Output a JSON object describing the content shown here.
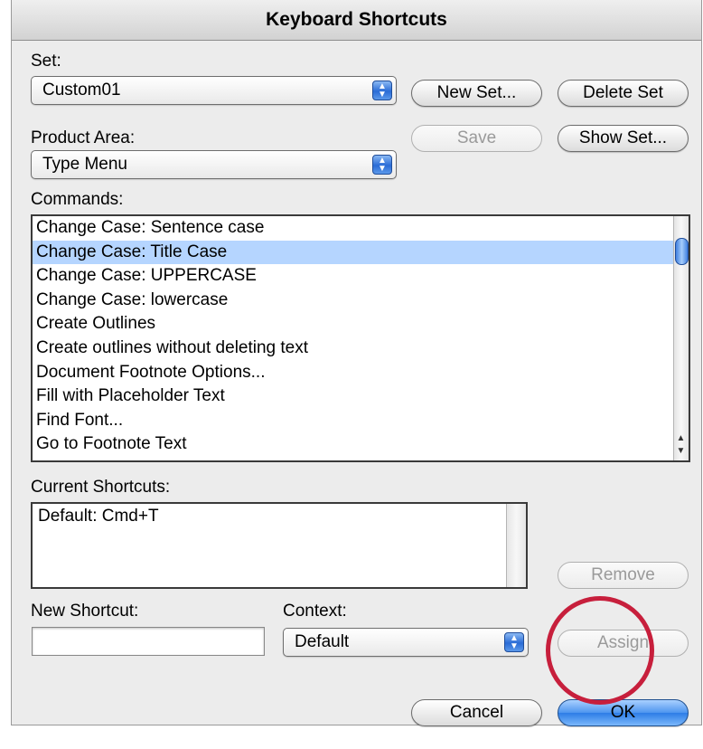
{
  "window": {
    "title": "Keyboard Shortcuts"
  },
  "set": {
    "label": "Set:",
    "value": "Custom01",
    "new_set_button": "New Set...",
    "delete_set_button": "Delete Set"
  },
  "product_area": {
    "label": "Product Area:",
    "value": "Type Menu",
    "save_button": "Save",
    "show_set_button": "Show Set..."
  },
  "commands": {
    "label": "Commands:",
    "items": [
      "Change Case: Sentence case",
      "Change Case: Title Case",
      "Change Case: UPPERCASE",
      "Change Case: lowercase",
      "Create Outlines",
      "Create outlines without deleting text",
      "Document Footnote Options...",
      "Fill with Placeholder Text",
      "Find Font...",
      "Go to Footnote Text"
    ],
    "selected_index": 1
  },
  "current_shortcuts": {
    "label": "Current Shortcuts:",
    "items": [
      "Default: Cmd+T"
    ],
    "remove_button": "Remove"
  },
  "new_shortcut": {
    "label": "New Shortcut:",
    "value": ""
  },
  "context": {
    "label": "Context:",
    "value": "Default",
    "assign_button": "Assign"
  },
  "footer": {
    "cancel_button": "Cancel",
    "ok_button": "OK"
  },
  "annotation": {
    "highlight_color": "#c71f3c"
  }
}
